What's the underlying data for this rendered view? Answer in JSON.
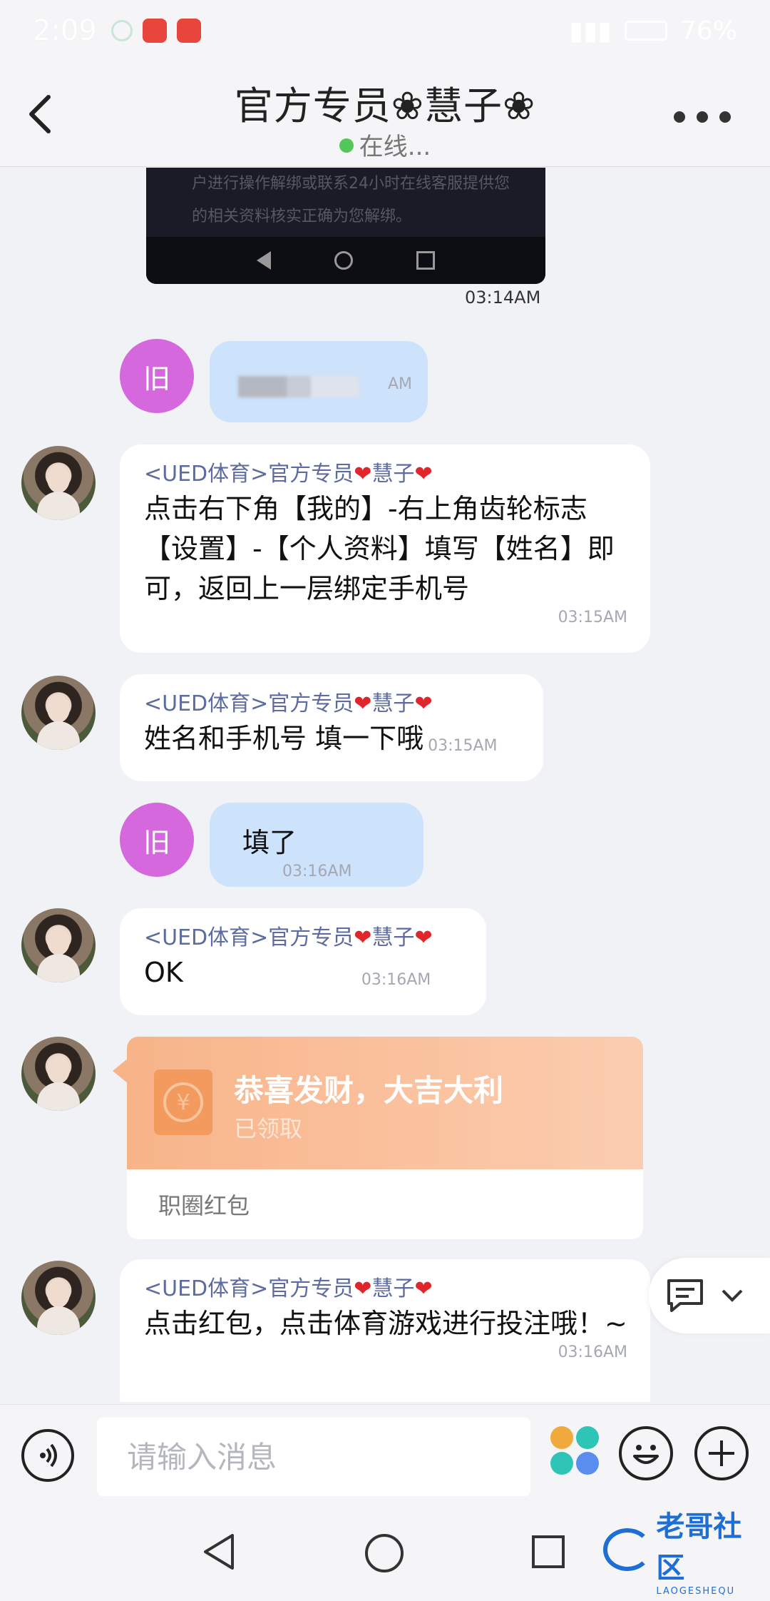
{
  "status_bar": {
    "time": "2:09",
    "battery": "76%"
  },
  "header": {
    "title": "官方专员❀慧子❀",
    "status": "在线..."
  },
  "image_message": {
    "lines": [
      "户进行操作解绑或联系24小时在线客服提供您",
      "的相关资料核实正确为您解绑。"
    ],
    "time": "03:14AM"
  },
  "messages": [
    {
      "from": "self",
      "avatar_label": "旧",
      "text": "",
      "time": "AM"
    },
    {
      "from": "agent",
      "sender_prefix": "<UED体育>官方专员",
      "sender_heart": "❤",
      "sender_name": "慧子",
      "text": "点击右下角【我的】-右上角齿轮标志【设置】-【个人资料】填写【姓名】即可，返回上一层绑定手机号",
      "time": "03:15AM"
    },
    {
      "from": "agent",
      "sender_prefix": "<UED体育>官方专员",
      "sender_heart": "❤",
      "sender_name": "慧子",
      "text": "姓名和手机号 填一下哦",
      "time": "03:15AM"
    },
    {
      "from": "self",
      "avatar_label": "旧",
      "text": "填了",
      "time": "03:16AM"
    },
    {
      "from": "agent",
      "sender_prefix": "<UED体育>官方专员",
      "sender_heart": "❤",
      "sender_name": "慧子",
      "text": "OK",
      "time": "03:16AM"
    },
    {
      "from": "agent",
      "type": "red_packet",
      "title": "恭喜发财，大吉大利",
      "status": "已领取",
      "footer": "职圈红包",
      "coin_symbol": "¥"
    },
    {
      "from": "agent",
      "sender_prefix": "<UED体育>官方专员",
      "sender_heart": "❤",
      "sender_name": "慧子",
      "text": "点击红包，点击体育游戏进行投注哦！~",
      "time": "03:16AM"
    }
  ],
  "input_bar": {
    "placeholder": "请输入消息"
  },
  "watermark": {
    "text": "老哥社区",
    "subtext": "LAOGESHEQU"
  },
  "colors": {
    "self_bubble": "#cde2fb",
    "self_avatar": "#d468dc",
    "sender_name": "#5d6ba0",
    "heart": "#e0262a",
    "online": "#53c85a",
    "packet": "#f8b489"
  },
  "icons": {
    "back": "chevron-left-icon",
    "more": "more-dots-icon",
    "voice": "voice-icon",
    "apps": "apps-icon",
    "emoji": "emoji-icon",
    "plus": "plus-icon",
    "quick_reply": "quick-reply-icon",
    "collapse": "chevron-down-icon"
  }
}
